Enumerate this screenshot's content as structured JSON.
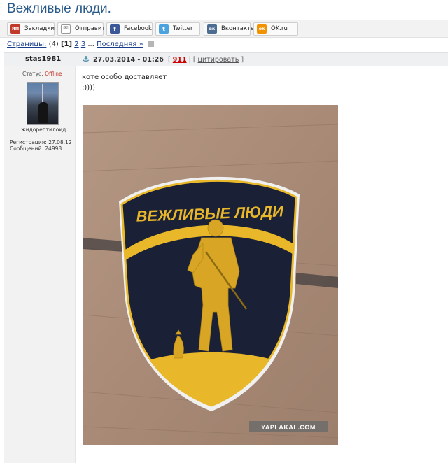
{
  "page": {
    "title": "Вежливые люди."
  },
  "share": {
    "buttons": [
      {
        "label": "Закладки",
        "icon": "yaplakal-icon",
        "ico_text": "ЯП",
        "color": "#c0392b"
      },
      {
        "label": "Отправить",
        "icon": "mail-icon",
        "ico_text": "✉",
        "color": "#888888"
      },
      {
        "label": "Facebook",
        "icon": "facebook-icon",
        "ico_text": "f",
        "color": "#3b5998"
      },
      {
        "label": "Twitter",
        "icon": "twitter-icon",
        "ico_text": "t",
        "color": "#4aa3df"
      },
      {
        "label": "Вконтакте",
        "icon": "vk-icon",
        "ico_text": "вк",
        "color": "#4c6c91"
      },
      {
        "label": "OK.ru",
        "icon": "odnoklassniki-icon",
        "ico_text": "ok",
        "color": "#f39200"
      }
    ]
  },
  "pagination": {
    "label": "Страницы:",
    "count": "(4)",
    "current": "[1]",
    "page2": "2",
    "page3": "3",
    "ellipsis": "...",
    "last": "Последняя »"
  },
  "post": {
    "author": "stas1981",
    "status_label": "Статус:",
    "status_value": "Offline",
    "user_title": "жидорептилоид",
    "reg_label": "Регистрация: 27.08.12",
    "messages_label": "Сообщений: 24998",
    "date": "27.03.2014 - 01:26",
    "post_number": "911",
    "quote_label": "цитировать",
    "text_line1": "коте особо доставляет",
    "text_line2": ":))))",
    "image": {
      "patch_text": "ВЕЖЛИВЫЕ ЛЮДИ",
      "watermark": "YAPLAKAL.COM"
    }
  },
  "colors": {
    "title": "#2a5a8a",
    "link": "#1a3f8a",
    "offline": "#c0392b",
    "post_number": "#cc0000",
    "patch_gold": "#e8b82a",
    "patch_navy": "#1a2036"
  }
}
